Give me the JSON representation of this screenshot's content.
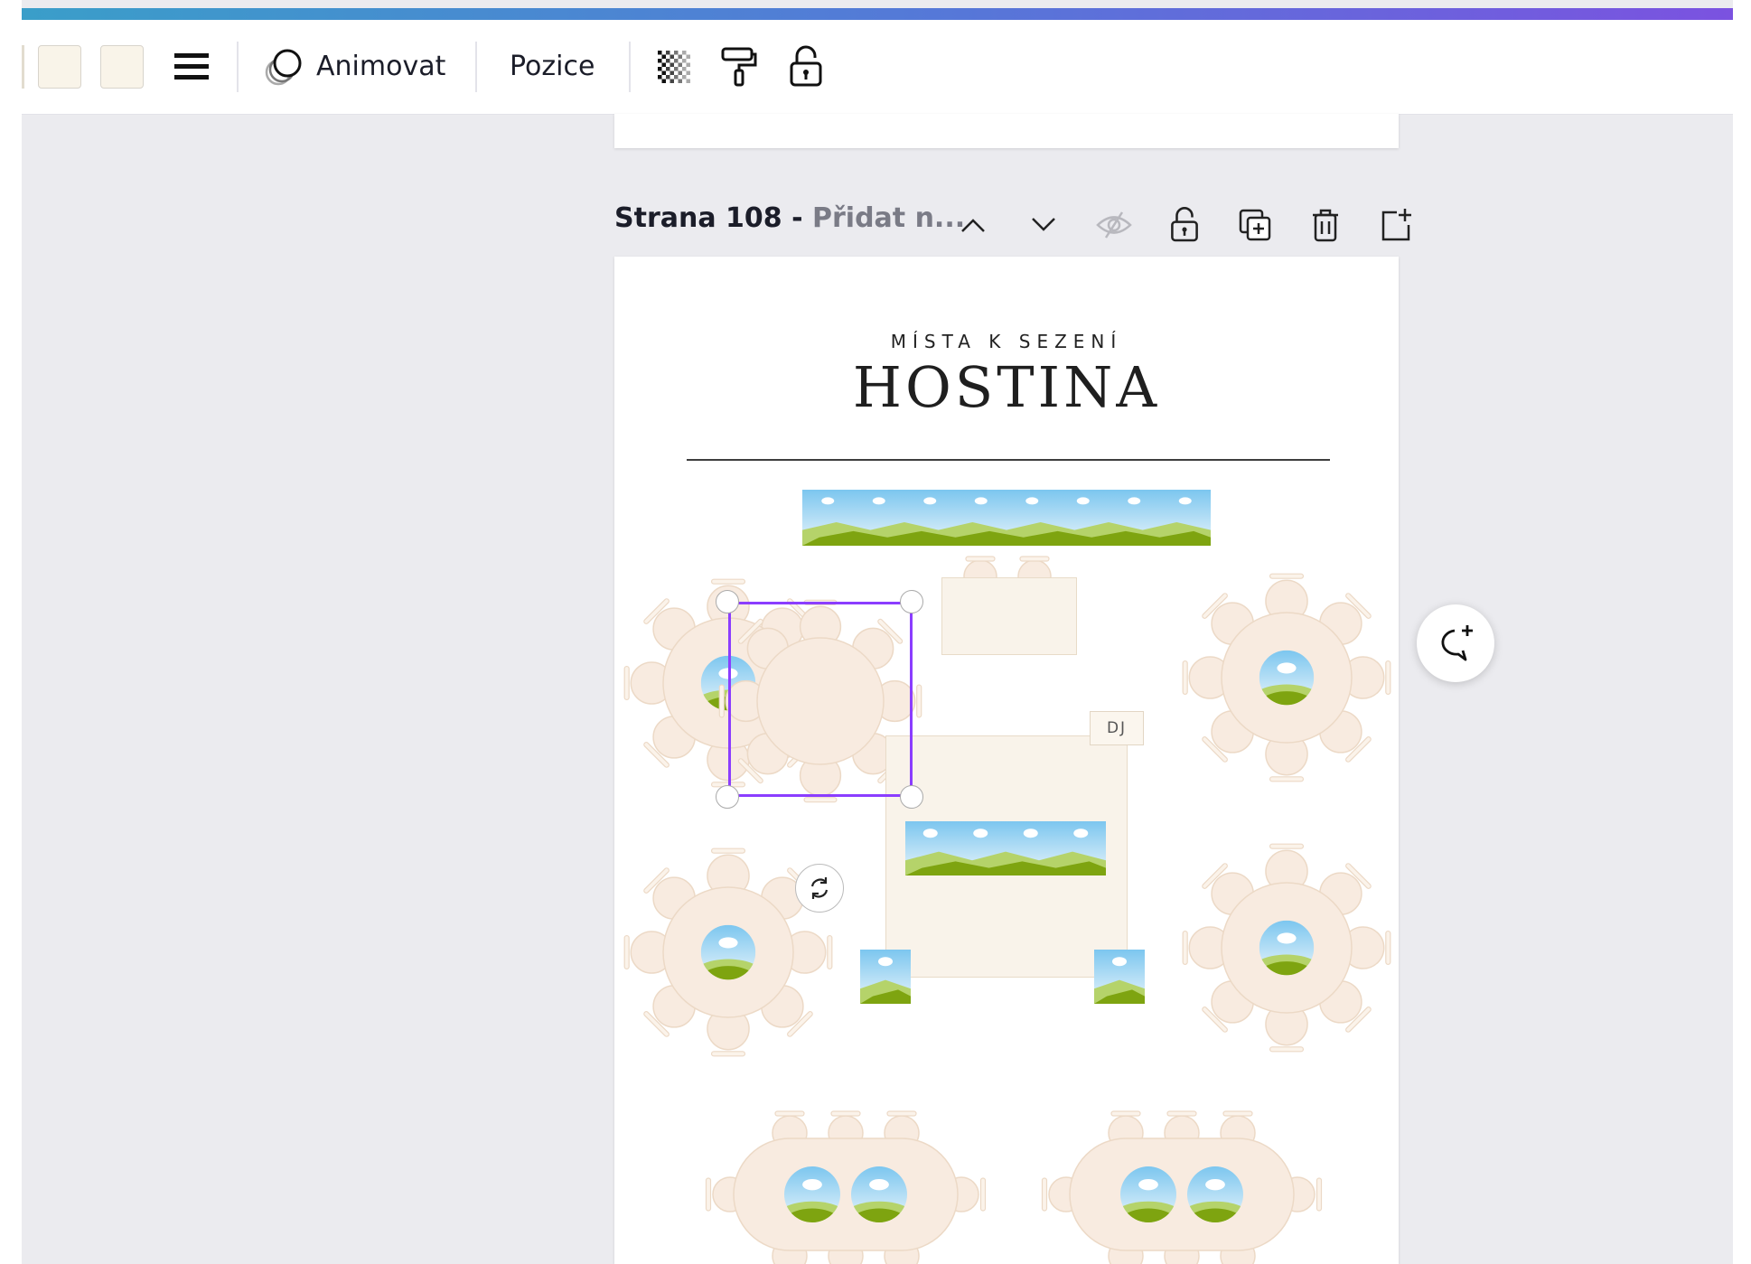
{
  "toolbar": {
    "animate_label": "Animovat",
    "position_label": "Pozice"
  },
  "page_header": {
    "title": "Strana 108 - ",
    "subtitle": "Přidat n..."
  },
  "design": {
    "subtitle": "MÍSTA K SEZENÍ",
    "title": "HOSTINA",
    "dj_label": "DJ"
  },
  "colors": {
    "accent": "#8b3dff",
    "table_fill": "#f8ebe0",
    "table_stroke": "#ecd9c6",
    "swatch": "#f9f4e9"
  },
  "icons": {
    "align": "align-lines-icon",
    "animate": "animate-icon",
    "transparency": "transparency-checker-icon",
    "paint": "paint-roller-icon",
    "lock": "lock-icon",
    "chevron_up": "chevron-up-icon",
    "chevron_down": "chevron-down-icon",
    "hide": "eye-hidden-icon",
    "duplicate": "duplicate-page-icon",
    "delete": "trash-icon",
    "add_page": "add-page-icon",
    "comment": "add-comment-icon",
    "rotate": "rotate-icon"
  }
}
